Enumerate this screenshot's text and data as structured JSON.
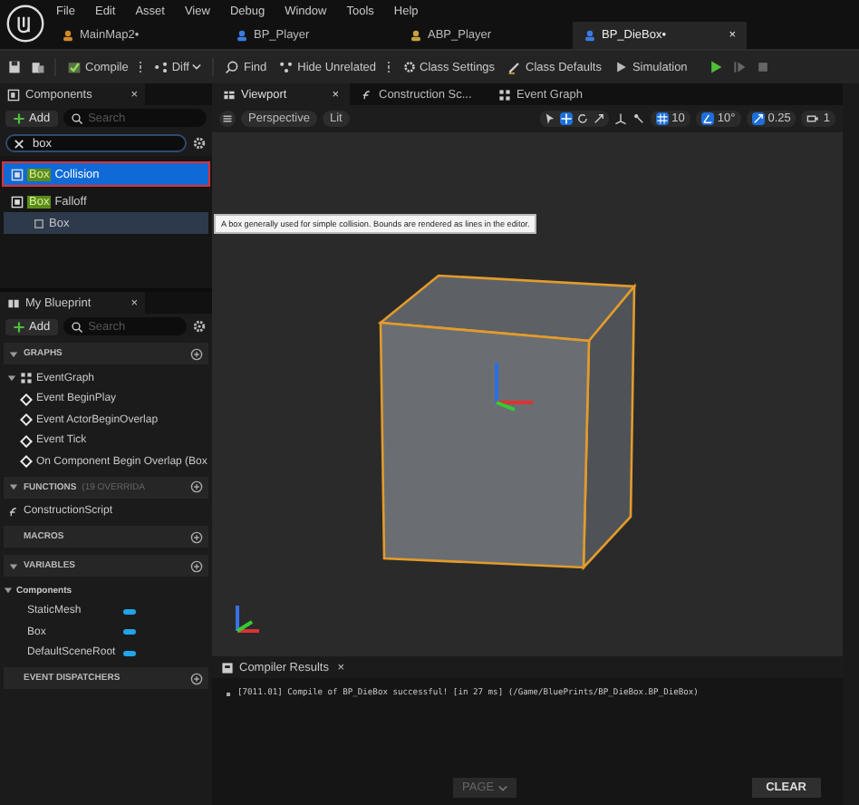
{
  "menu": [
    "File",
    "Edit",
    "Asset",
    "View",
    "Debug",
    "Window",
    "Tools",
    "Help"
  ],
  "doc_tabs": [
    {
      "label": "MainMap2•",
      "selected": false,
      "kind": "level"
    },
    {
      "label": "BP_Player",
      "selected": false,
      "kind": "blueprint"
    },
    {
      "label": "ABP_Player",
      "selected": false,
      "kind": "anim"
    },
    {
      "label": "BP_DieBox•",
      "selected": true,
      "kind": "blueprint",
      "close": "×"
    }
  ],
  "toolbar": {
    "compile": "Compile",
    "diff": "Diff",
    "find": "Find",
    "hide_unrelated": "Hide Unrelated",
    "class_settings": "Class Settings",
    "class_defaults": "Class Defaults",
    "simulation": "Simulation"
  },
  "components_panel": {
    "title": "Components",
    "close": "×",
    "add": "Add",
    "search_placeholder": "Search",
    "filter_value": "box",
    "items": [
      {
        "match": "Box",
        "rest": "Collision",
        "selected": true,
        "outlined": true
      },
      {
        "match": "Box",
        "rest": "Falloff",
        "selected": false,
        "outlined": false,
        "children": [
          {
            "label": "Box",
            "selected": true
          }
        ]
      }
    ]
  },
  "tooltip": "A box generally used for simple collision. Bounds are rendered as lines in the editor.",
  "viewport_tabs": [
    {
      "label": "Viewport",
      "selected": true,
      "kind": "viewport",
      "close": "×"
    },
    {
      "label": "Construction Sc...",
      "selected": false,
      "kind": "function"
    },
    {
      "label": "Event Graph",
      "selected": false,
      "kind": "graph"
    }
  ],
  "viewport_toolbar": {
    "view_mode": "Perspective",
    "lighting": "Lit",
    "grid_snap": "10",
    "rotation_snap": "10°",
    "scale_snap": "0.25",
    "camera_speed": "1"
  },
  "my_blueprint": {
    "title": "My Blueprint",
    "close": "×",
    "add": "Add",
    "search_placeholder": "Search",
    "sections": [
      {
        "title": "GRAPHS",
        "expanded": true,
        "items": [
          {
            "label": "EventGraph",
            "kind": "graph",
            "children": [
              {
                "label": "Event BeginPlay",
                "kind": "event"
              },
              {
                "label": "Event ActorBeginOverlap",
                "kind": "event"
              },
              {
                "label": "Event Tick",
                "kind": "event"
              },
              {
                "label": "On Component Begin Overlap (Box",
                "kind": "event"
              }
            ]
          }
        ]
      },
      {
        "title": "FUNCTIONS",
        "note": "(19 OVERRIDA",
        "expanded": true,
        "items": [
          {
            "label": "ConstructionScript",
            "kind": "function"
          }
        ]
      },
      {
        "title": "MACROS",
        "expanded": false
      },
      {
        "title": "VARIABLES",
        "expanded": true,
        "items": [
          {
            "label": "Components",
            "kind": "category",
            "children": [
              {
                "label": "StaticMesh",
                "kind": "variable"
              },
              {
                "label": "Box",
                "kind": "variable"
              },
              {
                "label": "DefaultSceneRoot",
                "kind": "variable"
              }
            ]
          }
        ]
      },
      {
        "title": "EVENT DISPATCHERS",
        "expanded": false
      }
    ]
  },
  "compiler_results": {
    "title": "Compiler Results",
    "close": "×",
    "messages": [
      "[7011.01] Compile of BP_DieBox successful! [in 27 ms] (/Game/BluePrints/BP_DieBox.BP_DieBox)"
    ],
    "page": "PAGE",
    "clear": "CLEAR"
  }
}
